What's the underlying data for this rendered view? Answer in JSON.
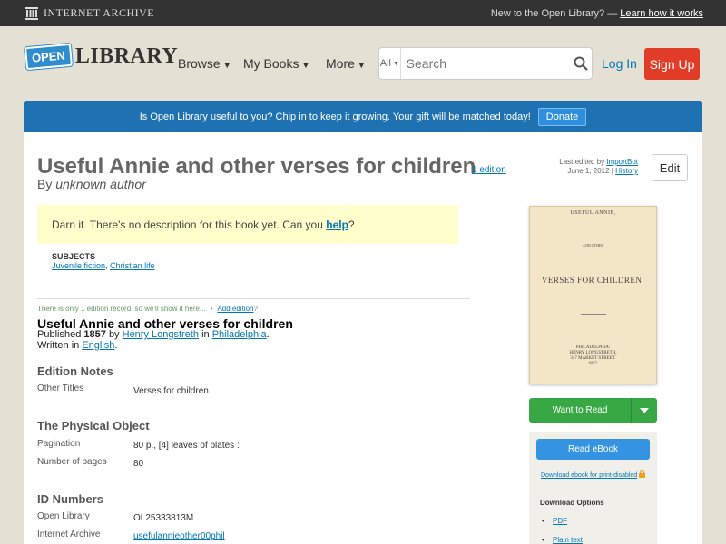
{
  "topbar": {
    "ia_name": "Internet Archive",
    "new_text": "New to the Open Library? —",
    "learn_link": "Learn how it works"
  },
  "header": {
    "logo_open": "OPEN",
    "logo_library": "LIBRARY",
    "nav": [
      "Browse",
      "My Books",
      "More"
    ],
    "search_scope": "All",
    "search_placeholder": "Search",
    "login": "Log In",
    "signup": "Sign Up"
  },
  "donate": {
    "text": "Is Open Library useful to you? Chip in to keep it growing. Your gift will be matched today!",
    "button": "Donate"
  },
  "work": {
    "title": "Useful Annie and other verses for children",
    "edition_count": "1 edition",
    "by": "By",
    "author": "unknown author",
    "last_edited_by": "Last edited by",
    "editor": "ImportBot",
    "edit_date": "June 1, 2012",
    "history": "History",
    "edit_button": "Edit",
    "description_prefix": "Darn it. There's no description for this book yet. Can you",
    "description_link": "help",
    "description_suffix": "?",
    "subjects_heading": "SUBJECTS",
    "subjects": [
      "Juvenile fiction",
      "Christian life"
    ]
  },
  "edition": {
    "only_note": "There is only 1 edition record, so we'll show it here...",
    "add_edition": "Add edition",
    "title": "Useful Annie and other verses for children",
    "published_label": "Published",
    "year": "1857",
    "by": "by",
    "publisher": "Henry Longstreth",
    "in": "in",
    "place": "Philadelphia",
    "written_in": "Written in",
    "language": "English",
    "edition_notes_heading": "Edition Notes",
    "other_titles_label": "Other Titles",
    "other_titles_value": "Verses for children.",
    "physical_heading": "The Physical Object",
    "pagination_label": "Pagination",
    "pagination_value": "80 p., [4] leaves of plates :",
    "pages_label": "Number of pages",
    "pages_value": "80",
    "id_heading": "ID Numbers",
    "ol_label": "Open Library",
    "ol_value": "OL25333813M",
    "ia_label": "Internet Archive",
    "ia_value": "usefulannieother00phil"
  },
  "cover": {
    "line1": "USEFUL ANNIE,",
    "line2": "AND OTHER",
    "line3": "VERSES FOR CHILDREN.",
    "line4": "PHILADELPHIA:",
    "line5": "HENRY LONGSTRETH,",
    "line6": "347 MARKET STREET.",
    "line7": "1857."
  },
  "sidebar": {
    "want_to_read": "Want to Read",
    "read_ebook": "Read eBook",
    "download_print": "Download ebook for print-disabled",
    "download_options": "Download Options",
    "options": [
      "PDF",
      "Plain text"
    ]
  }
}
